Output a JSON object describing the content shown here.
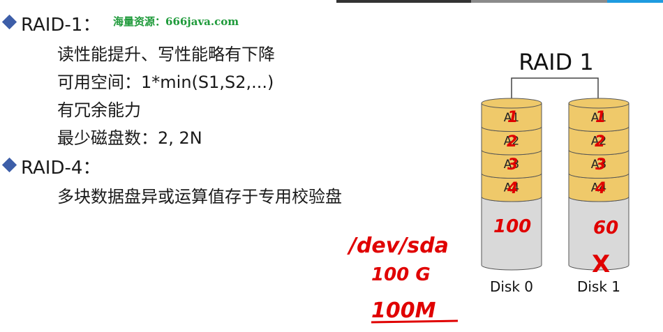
{
  "raid1": {
    "heading": "RAID-1：",
    "watermark": "海量资源：666java.com",
    "lines": [
      "读性能提升、写性能略有下降",
      "可用空间：1*min(S1,S2,...)",
      "有冗余能力",
      "最少磁盘数：2, 2N"
    ]
  },
  "raid4": {
    "heading": "RAID-4：",
    "lines": [
      "多块数据盘异或运算值存于专用校验盘"
    ]
  },
  "diagram": {
    "title": "RAID 1",
    "disks": [
      {
        "label": "Disk 0",
        "blocks": [
          "A1",
          "A2",
          "A3",
          "A4"
        ]
      },
      {
        "label": "Disk 1",
        "blocks": [
          "A1",
          "A2",
          "A3",
          "A4"
        ]
      }
    ],
    "colors": {
      "block": "#efc96a",
      "empty": "#d9d9d9",
      "stroke": "#555555"
    }
  },
  "annotations": {
    "disk0_marks": [
      "1",
      "2",
      "3",
      "4"
    ],
    "disk0_size": "100",
    "disk1_marks": [
      "1",
      "2",
      "3",
      "4"
    ],
    "disk1_size": "60",
    "disk1_fail": "X",
    "device": "/dev/sda",
    "size1": "100 G",
    "size2": "100M",
    "ink_color": "#e00000"
  }
}
